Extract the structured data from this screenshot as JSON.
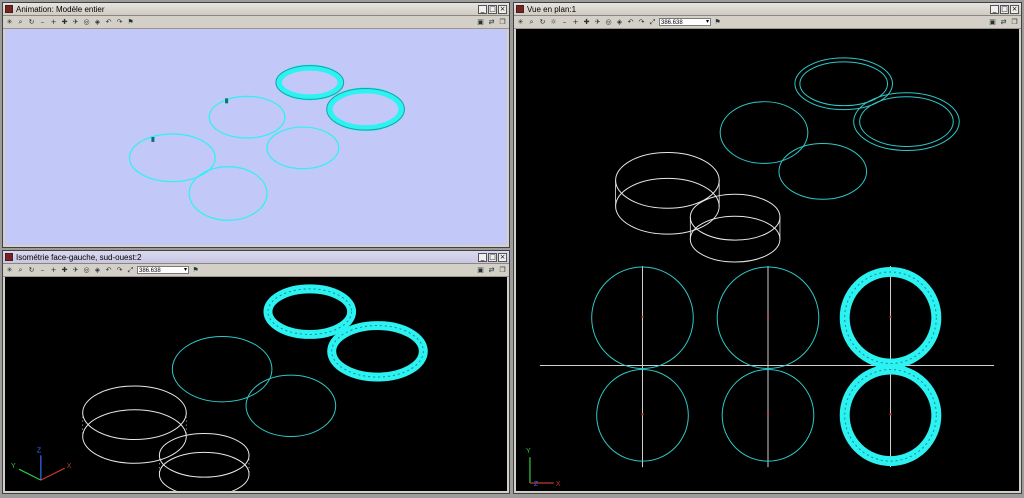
{
  "windows": {
    "animation": {
      "title": "Animation: Modèle entier",
      "viewport_bg": "#c2c8f8"
    },
    "iso": {
      "title": "Isométrie face-gauche, sud-ouest:2",
      "zoom": "386.638",
      "viewport_bg": "#000000"
    },
    "plan": {
      "title": "Vue en plan:1",
      "zoom": "386.638",
      "viewport_bg": "#000000"
    }
  },
  "triad": {
    "x": "X",
    "y": "Y",
    "z": "Z"
  },
  "colors": {
    "cyan": "#2cf2f2",
    "wire": "#2fc8c8",
    "white": "#e8e8e8"
  },
  "icons": [
    "asterisk-icon",
    "zoom-icon",
    "orbit-icon",
    "dash-icon",
    "pan-plus-icon",
    "move-icon",
    "fly-icon",
    "camera-icon",
    "view-icon",
    "undo-icon",
    "redo-icon",
    "zoom-field-icon",
    "flag-icon"
  ]
}
